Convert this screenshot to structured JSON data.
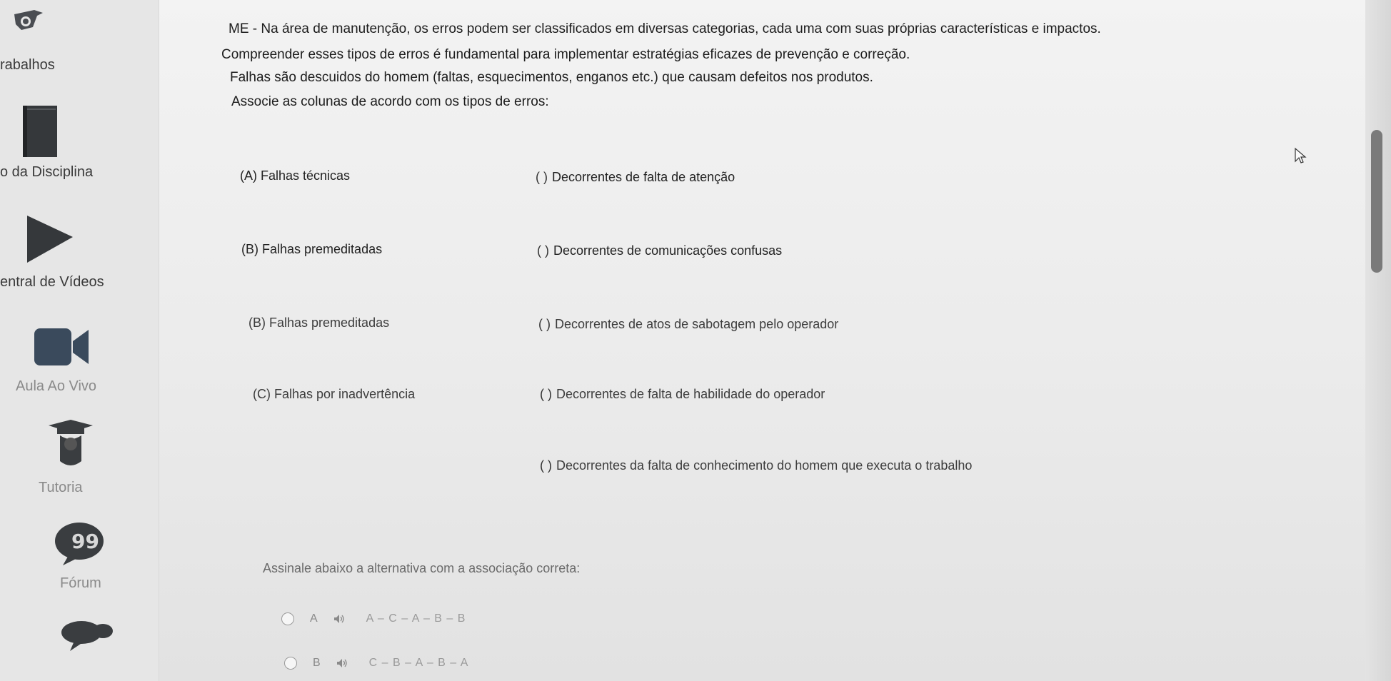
{
  "sidebar": {
    "items": [
      {
        "label": "rabalhos",
        "icon": "bird-icon"
      },
      {
        "label": "o da Disciplina",
        "icon": "book-icon"
      },
      {
        "label": "entral de Vídeos",
        "icon": "play-icon"
      },
      {
        "label": "Aula Ao Vivo",
        "icon": "video-camera-icon"
      },
      {
        "label": "Tutoria",
        "icon": "graduation-cap-icon"
      },
      {
        "label": "Fórum",
        "icon": "quote-bubble-icon"
      },
      {
        "label": "",
        "icon": "chat-bubble-icon"
      }
    ]
  },
  "question": {
    "lines": [
      "ME - Na área de manutenção, os erros podem ser classificados em diversas categorias, cada uma com suas próprias características e impactos.",
      "Compreender esses tipos de erros é fundamental para implementar estratégias eficazes de prevenção e correção.",
      "Falhas são descuidos do homem (faltas, esquecimentos, enganos etc.) que causam defeitos nos produtos.",
      "Associe as colunas de acordo com os tipos de erros:"
    ],
    "column_a": [
      "(A) Falhas técnicas",
      "(B) Falhas premeditadas",
      "(B) Falhas premeditadas",
      "(C) Falhas por inadvertência"
    ],
    "column_b": [
      {
        "paren": "(   )",
        "text": "Decorrentes de falta de atenção"
      },
      {
        "paren": "(   )",
        "text": "Decorrentes de comunicações confusas"
      },
      {
        "paren": "( )",
        "text": "Decorrentes de atos de sabotagem pelo operador"
      },
      {
        "paren": "( )",
        "text": "Decorrentes de falta de habilidade do operador"
      },
      {
        "paren": "( )",
        "text": "Decorrentes da falta de conhecimento do homem que executa o trabalho"
      }
    ],
    "instruction": "Assinale abaixo a alternativa com a associação correta:",
    "options": [
      {
        "letter": "A",
        "text": "A – C – A – B – B"
      },
      {
        "letter": "B",
        "text": "C – B – A – B – A"
      }
    ]
  },
  "colors": {
    "sidebar_icon": "#3a3d40",
    "scroll_thumb": "#7a7a7a"
  }
}
